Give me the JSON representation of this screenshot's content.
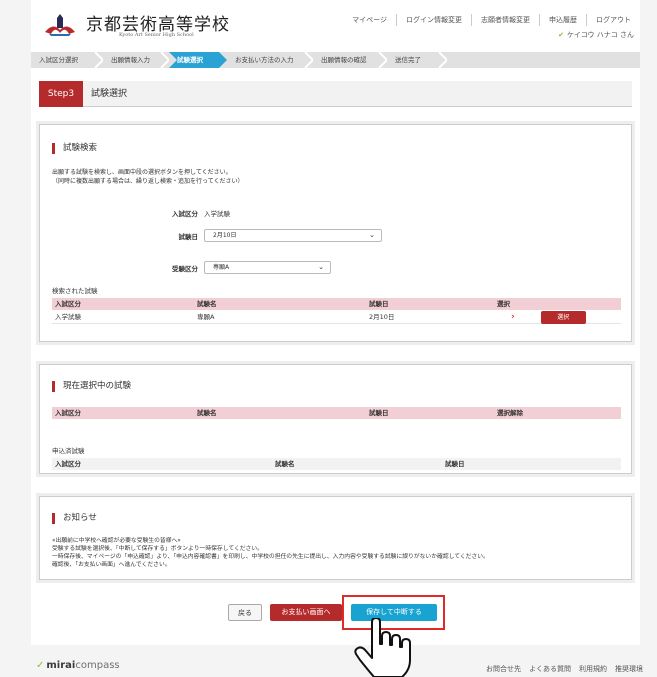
{
  "header": {
    "school_name": "京都芸術高等学校",
    "school_sub": "Kyoto Art Senior High School",
    "nav": [
      "マイページ",
      "ログイン情報変更",
      "志願者情報変更",
      "申込履歴",
      "ログアウト"
    ],
    "user_name": "ケイコウ ハナコ さん"
  },
  "steps": [
    {
      "label": "入試区分選択",
      "active": false
    },
    {
      "label": "出願情報入力",
      "active": false
    },
    {
      "label": "試験選択",
      "active": true
    },
    {
      "label": "お支払い方法の入力",
      "active": false
    },
    {
      "label": "出願情報の確認",
      "active": false
    },
    {
      "label": "送信完了",
      "active": false
    }
  ],
  "step_heading": {
    "badge": "Step3",
    "title": "試験選択"
  },
  "search": {
    "title": "試験検索",
    "desc_line1": "出願する試験を検索し、画面中段の選択ボタンを押してください。",
    "desc_line2": "（同時に複数出願する場合は、繰り返し検索・追加を行ってください）",
    "exam_type_label": "入試区分",
    "exam_type_value": "入学試験",
    "date_label": "試験日",
    "date_value": "2月10日",
    "category_label": "受験区分",
    "category_value": "専願A",
    "results_label": "検索された試験",
    "columns": [
      "入試区分",
      "試験名",
      "試験日",
      "選択"
    ],
    "rows": [
      {
        "exam_type": "入学試験",
        "name": "専願A",
        "date": "2月10日",
        "button": "選択"
      }
    ]
  },
  "current": {
    "title": "現在選択中の試験",
    "columns": [
      "入試区分",
      "試験名",
      "試験日",
      "選択解除"
    ],
    "applied_label": "申込済試験",
    "applied_columns": [
      "入試区分",
      "試験名",
      "試験日"
    ]
  },
  "notice": {
    "title": "お知らせ",
    "lines": [
      "«出願前に中学校へ確認が必要な受験生の皆様へ»",
      "受験する試験を選択後、「中断して保存する」ボタンより一時保存してください。",
      "一時保存後、マイページの「申込確認」より、「申込内容確認書」を印刷し、中学校の担任の先生に提出し、入力内容や受験する試験に誤りがないか確認してください。",
      "確認後、「お支払い画面」へ進んでください。"
    ]
  },
  "buttons": {
    "back": "戻る",
    "pay": "お支払い画面へ",
    "save": "保存して中断する"
  },
  "footer": {
    "logo_bold": "mirai",
    "logo_rest": "compass",
    "links": [
      "お問合せ先",
      "よくある質問",
      "利用規約",
      "推奨環境"
    ]
  },
  "colors": {
    "accent": "#b52b2b",
    "save_button": "#19a3d1",
    "table_header": "#f2cfd4",
    "highlight": "#e02a2a"
  }
}
